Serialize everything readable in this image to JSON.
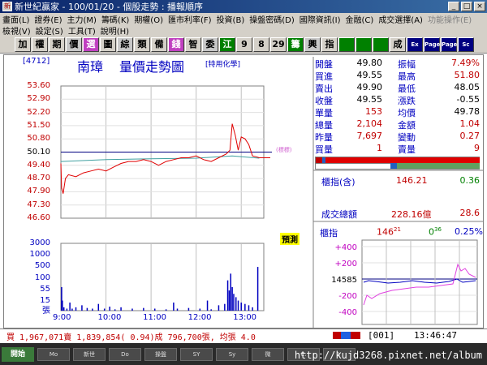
{
  "window": {
    "title": "新世紀贏家 - 100/01/20 - 個股走勢 : 播報順序",
    "icon_label": "新"
  },
  "menu": {
    "row1": [
      "畫面(L)",
      "證券(E)",
      "主力(M)",
      "籌碼(K)",
      "期權(O)",
      "匯市利率(F)",
      "投資(B)",
      "操盤密碼(D)",
      "國際資訊(I)",
      "金融(C)",
      "成交選擇(A)",
      "功能操作(E)"
    ],
    "row1_disabled": [
      11
    ],
    "row2": [
      "檢視(V)",
      "設定(S)",
      "工具(T)",
      "說明(H)"
    ]
  },
  "toolbar": {
    "buttons": [
      "加",
      "權",
      "期",
      "價",
      "選",
      "圖",
      "綜",
      "類",
      "備",
      "錢",
      "智",
      "委",
      "江",
      "9",
      "8",
      "29",
      "籌",
      "興",
      "指",
      "",
      "",
      "",
      "成",
      "Ex",
      "Page",
      "Page",
      "Sc"
    ]
  },
  "stock": {
    "code": "[4712]",
    "name": "南璋",
    "chart_title": "量價走勢圖",
    "industry": "[特用化學]"
  },
  "chart_data": {
    "type": "line",
    "price_axis": {
      "ticks": [
        "53.60",
        "52.90",
        "52.20",
        "51.50",
        "50.80",
        "50.10",
        "49.40",
        "48.70",
        "47.90",
        "47.30",
        "46.60"
      ],
      "ref_price": "50.10",
      "ylim": [
        46.6,
        53.6
      ]
    },
    "volume_axis": {
      "ticks": [
        "3000",
        "1000",
        "500",
        "100",
        "55",
        "15"
      ],
      "unit": "張"
    },
    "x_ticks": [
      "9:00",
      "10:00",
      "11:00",
      "12:00",
      "13:00"
    ],
    "price_series": [
      [
        0,
        49.5
      ],
      [
        1,
        48.2
      ],
      [
        3,
        47.9
      ],
      [
        6,
        48.7
      ],
      [
        10,
        48.9
      ],
      [
        20,
        48.8
      ],
      [
        30,
        49.0
      ],
      [
        40,
        49.1
      ],
      [
        50,
        49.2
      ],
      [
        60,
        49.1
      ],
      [
        70,
        49.3
      ],
      [
        80,
        49.5
      ],
      [
        90,
        49.6
      ],
      [
        100,
        49.6
      ],
      [
        110,
        49.7
      ],
      [
        120,
        49.6
      ],
      [
        130,
        49.4
      ],
      [
        140,
        49.6
      ],
      [
        150,
        49.7
      ],
      [
        160,
        49.8
      ],
      [
        170,
        49.8
      ],
      [
        180,
        49.9
      ],
      [
        190,
        49.7
      ],
      [
        200,
        49.6
      ],
      [
        210,
        49.8
      ],
      [
        220,
        50.0
      ],
      [
        225,
        50.2
      ],
      [
        228,
        51.6
      ],
      [
        232,
        51.0
      ],
      [
        236,
        50.2
      ],
      [
        240,
        50.9
      ],
      [
        245,
        50.8
      ],
      [
        250,
        50.5
      ],
      [
        255,
        49.9
      ],
      [
        260,
        49.85
      ],
      [
        264,
        49.8
      ]
    ],
    "avg_series": [
      [
        0,
        49.6
      ],
      [
        60,
        49.7
      ],
      [
        120,
        49.75
      ],
      [
        180,
        49.78
      ],
      [
        228,
        49.9
      ],
      [
        264,
        49.78
      ]
    ],
    "volume_series": [
      [
        1,
        0.35
      ],
      [
        2,
        0.15
      ],
      [
        4,
        0.05
      ],
      [
        8,
        0.03
      ],
      [
        12,
        0.12
      ],
      [
        15,
        0.03
      ],
      [
        20,
        0.05
      ],
      [
        28,
        0.08
      ],
      [
        35,
        0.04
      ],
      [
        42,
        0.03
      ],
      [
        50,
        0.1
      ],
      [
        58,
        0.03
      ],
      [
        65,
        0.06
      ],
      [
        72,
        0.02
      ],
      [
        80,
        0.05
      ],
      [
        95,
        0.03
      ],
      [
        110,
        0.04
      ],
      [
        125,
        0.03
      ],
      [
        140,
        0.02
      ],
      [
        150,
        0.12
      ],
      [
        155,
        0.03
      ],
      [
        170,
        0.04
      ],
      [
        185,
        0.03
      ],
      [
        195,
        0.15
      ],
      [
        200,
        0.02
      ],
      [
        210,
        0.08
      ],
      [
        218,
        0.1
      ],
      [
        222,
        0.45
      ],
      [
        224,
        0.3
      ],
      [
        226,
        0.55
      ],
      [
        228,
        0.35
      ],
      [
        230,
        0.25
      ],
      [
        233,
        0.2
      ],
      [
        236,
        0.15
      ],
      [
        240,
        0.12
      ],
      [
        245,
        0.1
      ],
      [
        250,
        0.08
      ],
      [
        255,
        0.05
      ],
      [
        262,
        0.65
      ]
    ],
    "total_minutes": 270
  },
  "ref_note": "(標標)",
  "intraday_badge": "預測",
  "quote": {
    "rows": [
      {
        "k1": "開盤",
        "v1": "49.80",
        "c1": "#000000",
        "k2": "振幅",
        "v2": "7.49%",
        "c2": "#c00000"
      },
      {
        "k1": "買進",
        "v1": "49.55",
        "c1": "#000000",
        "k2": "最高",
        "v2": "51.80",
        "c2": "#c00000"
      },
      {
        "k1": "賣出",
        "v1": "49.90",
        "c1": "#000000",
        "k2": "最低",
        "v2": "48.05",
        "c2": "#000000"
      },
      {
        "k1": "收盤",
        "v1": "49.55",
        "c1": "#000000",
        "k2": "漲跌",
        "v2": "-0.55",
        "c2": "#000000"
      },
      {
        "k1": "單量",
        "v1": "153",
        "c1": "#c00000",
        "k2": "均價",
        "v2": "49.78",
        "c2": "#000000"
      },
      {
        "k1": "總量",
        "v1": "2,104",
        "c1": "#c00000",
        "k2": "金額",
        "v2": "1.04",
        "c2": "#c00000"
      },
      {
        "k1": "昨量",
        "v1": "7,697",
        "c1": "#c00000",
        "k2": "變動",
        "v2": "0.27",
        "c2": "#c00000"
      },
      {
        "k1": "買量",
        "v1": "1",
        "c1": "#c00000",
        "k2": "賣量",
        "v2": "9",
        "c2": "#c00000"
      }
    ]
  },
  "index": {
    "label": "櫃指(含)",
    "value": "146.21",
    "change": "0.36",
    "turnover_label": "成交總額",
    "turnover_value": "228.16億",
    "turnover_change": "28.6"
  },
  "mini_chart": {
    "title": "櫃指",
    "value_main": "146",
    "value_sup": "21",
    "change_main": "0",
    "change_sup": "36",
    "pct": "0.25%",
    "ticks": [
      "+400",
      "+200",
      "14585",
      "-200",
      "-400"
    ]
  },
  "status": {
    "left": "買 1,967,071賣 1,839,854( 0.94)成 796,700張, 均張 4.0",
    "input_value": "001",
    "time": "13:46:47"
  },
  "taskbar": {
    "start_label": "開始",
    "buttons": [
      "Mo",
      "新世",
      "Do",
      "操盤",
      "SY",
      "Sy",
      "微",
      "C:",
      "Y"
    ],
    "watermark": "http://kujd3268.pixnet.net/album"
  }
}
